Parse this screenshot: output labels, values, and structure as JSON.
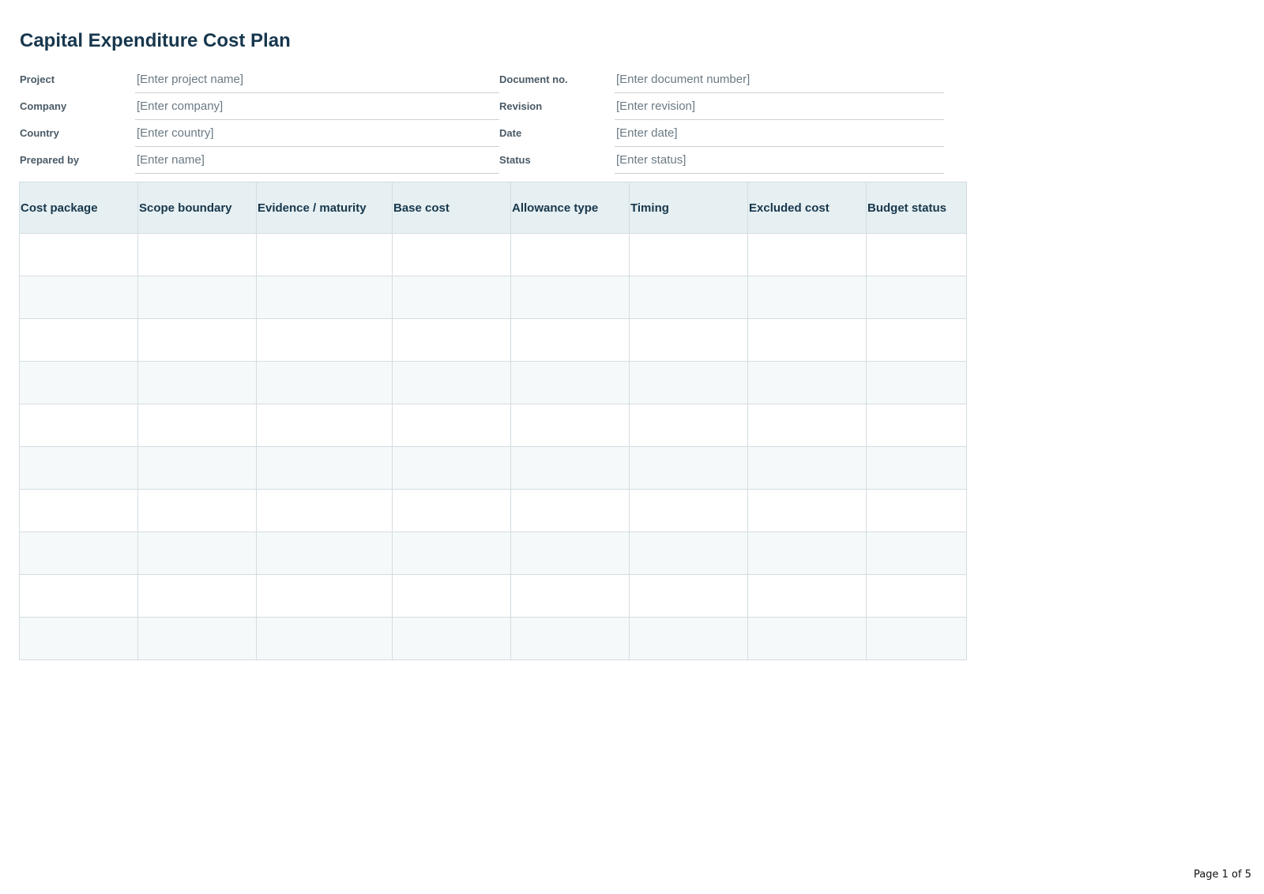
{
  "document": {
    "title": "Capital Expenditure Cost Plan"
  },
  "meta_rows": [
    {
      "left_label": "Project",
      "left_value": "[Enter project name]",
      "right_label": "Document no.",
      "right_value": "[Enter document number]"
    },
    {
      "left_label": "Company",
      "left_value": "[Enter company]",
      "right_label": "Revision",
      "right_value": "[Enter revision]"
    },
    {
      "left_label": "Country",
      "left_value": "[Enter country]",
      "right_label": "Date",
      "right_value": "[Enter date]"
    },
    {
      "left_label": "Prepared by",
      "left_value": "[Enter name]",
      "right_label": "Status",
      "right_value": "[Enter status]"
    }
  ],
  "table": {
    "columns": [
      "Cost package",
      "Scope boundary",
      "Evidence / maturity",
      "Base cost",
      "Allowance type",
      "Timing",
      "Excluded cost",
      "Budget status"
    ],
    "rows": [
      [
        "",
        "",
        "",
        "",
        "",
        "",
        "",
        ""
      ],
      [
        "",
        "",
        "",
        "",
        "",
        "",
        "",
        ""
      ],
      [
        "",
        "",
        "",
        "",
        "",
        "",
        "",
        ""
      ],
      [
        "",
        "",
        "",
        "",
        "",
        "",
        "",
        ""
      ],
      [
        "",
        "",
        "",
        "",
        "",
        "",
        "",
        ""
      ],
      [
        "",
        "",
        "",
        "",
        "",
        "",
        "",
        ""
      ],
      [
        "",
        "",
        "",
        "",
        "",
        "",
        "",
        ""
      ],
      [
        "",
        "",
        "",
        "",
        "",
        "",
        "",
        ""
      ],
      [
        "",
        "",
        "",
        "",
        "",
        "",
        "",
        ""
      ],
      [
        "",
        "",
        "",
        "",
        "",
        "",
        "",
        ""
      ]
    ]
  },
  "footer": {
    "page_label": "Page 1 of 5"
  }
}
